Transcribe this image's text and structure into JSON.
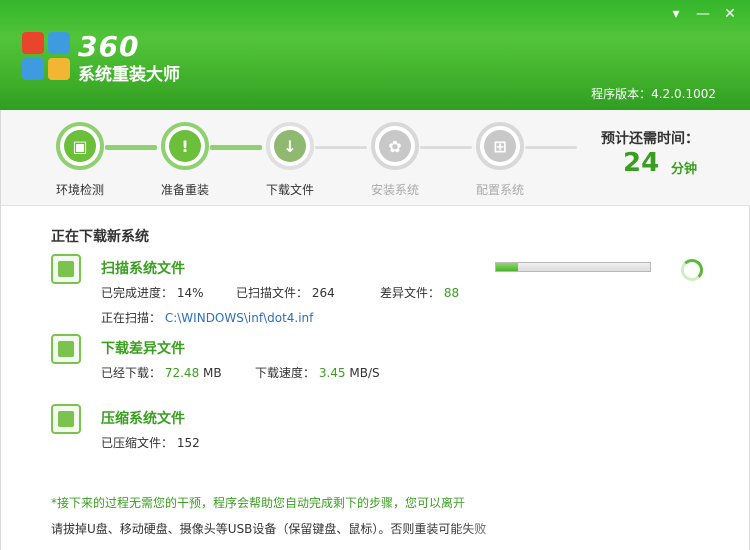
{
  "app": {
    "logo_number": "360",
    "logo_subtitle": "系统重装大师",
    "version_text": "程序版本：4.2.0.1002"
  },
  "window_buttons": {
    "menu": "▾",
    "minimize": "—",
    "close": "✕"
  },
  "steps": [
    {
      "label": "环境检测",
      "state": "done",
      "icon": "monitor-icon",
      "glyph": "▣"
    },
    {
      "label": "准备重装",
      "state": "done",
      "icon": "document-alert-icon",
      "glyph": "!"
    },
    {
      "label": "下载文件",
      "state": "current",
      "icon": "download-icon",
      "glyph": "↓"
    },
    {
      "label": "安装系统",
      "state": "todo",
      "icon": "install-icon",
      "glyph": "✿"
    },
    {
      "label": "配置系统",
      "state": "todo",
      "icon": "windows-icon",
      "glyph": "⊞"
    }
  ],
  "time": {
    "title": "预计还需时间：",
    "value": "24",
    "unit": "分钟"
  },
  "main": {
    "section_title": "正在下载新系统",
    "progress": 0.14,
    "tasks": {
      "scan": {
        "title": "扫描系统文件",
        "progress_label": "已完成进度：",
        "progress_value": "14%",
        "scanned_label": "已扫描文件：",
        "scanned_value": "264",
        "diff_label": "差异文件：",
        "diff_value": "88",
        "current_label": "正在扫描：",
        "current_path": "C:\\WINDOWS\\inf\\dot4.inf"
      },
      "download": {
        "title": "下载差异文件",
        "downloaded_label": "已经下载：",
        "downloaded_value": "72.48",
        "downloaded_unit": "MB",
        "speed_label": "下载速度：",
        "speed_value": "3.45",
        "speed_unit": "MB/S"
      },
      "compress": {
        "title": "压缩系统文件",
        "compressed_label": "已压缩文件：",
        "compressed_value": "152"
      }
    },
    "notes": {
      "line1": "*接下来的过程无需您的干预，程序会帮助您自动完成剩下的步骤，您可以离开",
      "line2": "请拔掉U盘、移动硬盘、摄像头等USB设备（保留键盘、鼠标）。否则重装可能失败"
    }
  },
  "colors": {
    "brand_green": "#3fae2a",
    "accent_green": "#3a9f20",
    "link_blue": "#2a6fbf"
  }
}
